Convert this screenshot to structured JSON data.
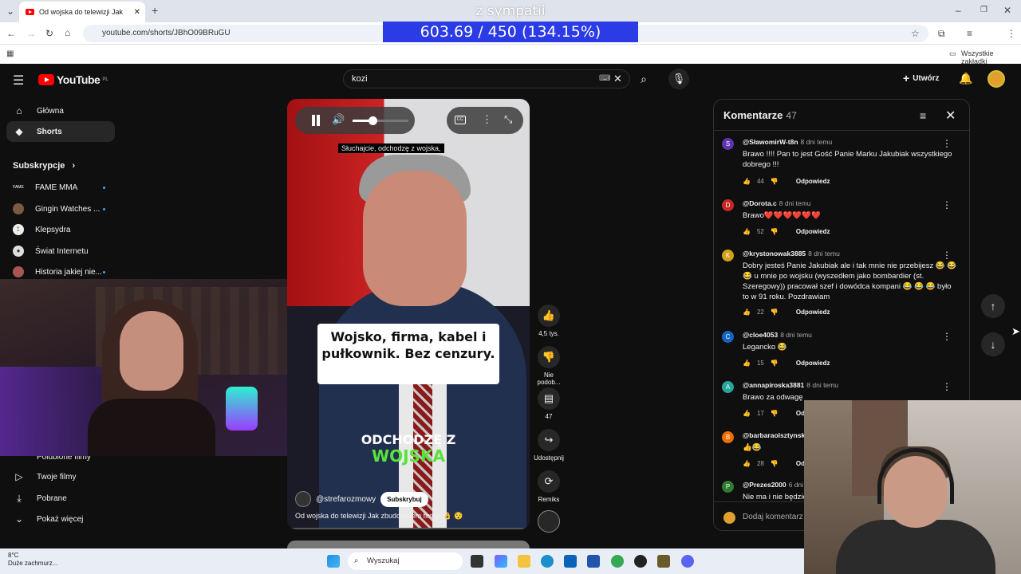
{
  "browser": {
    "tab_title": "Od wojska do telewizji Jak",
    "url": "youtube.com/shorts/JBhO09BRuGU",
    "bookmarks_label": "Wszystkie zakładki"
  },
  "overlay": {
    "top_text": "z sympatii",
    "banner_text": "603.69 / 450 (134.15%)"
  },
  "header": {
    "logo_text": "YouTube",
    "logo_region": "PL",
    "search_value": "kozi",
    "create_label": "Utwórz"
  },
  "sidebar": {
    "items": [
      {
        "label": "Główna",
        "icon": "home-icon"
      },
      {
        "label": "Shorts",
        "icon": "shorts-icon"
      }
    ],
    "subscriptions_label": "Subskrypcje",
    "subscriptions": [
      {
        "label": "FAME MMA"
      },
      {
        "label": "Gingin Watches ..."
      },
      {
        "label": "Klepsydra"
      },
      {
        "label": "Świat Internetu"
      },
      {
        "label": "Historia jakiej nie..."
      }
    ],
    "bottom_items": [
      {
        "label": "Polubione filmy"
      },
      {
        "label": "Twoje filmy"
      },
      {
        "label": "Pobrane"
      },
      {
        "label": "Pokaż więcej"
      }
    ]
  },
  "video": {
    "subtitle": "Słuchajcie, odchodzę z wojska,",
    "caption_box": "Wojsko, firma, kabel i pułkownik. Bez cenzury.",
    "big_line1": "ODCHODZĘ Z",
    "big_line2": "WOJSKA",
    "channel": "@strefarozmowy",
    "subscribe_label": "Subskrybuj",
    "title": "Od wojska do telewizji  Jak zbudowałem firmę! 👌 😯",
    "volume_level": 0.35
  },
  "actions": {
    "like_count": "4,5 tys.",
    "dislike_label": "Nie podob...",
    "comments_count": "47",
    "share_label": "Udostępnij",
    "remix_label": "Remiks"
  },
  "comments": {
    "title": "Komentarze",
    "count": "47",
    "add_placeholder": "Dodaj komentarz",
    "reply_label": "Odpowiedz",
    "items": [
      {
        "author": "@SławomirW-t8n",
        "time": "8 dni temu",
        "text": "Brawo !!!! Pan to jest Gość Panie Marku Jakubiak wszystkiego dobrego !!!",
        "likes": "44",
        "avatar": "S",
        "color": "#5e35b1"
      },
      {
        "author": "@Dorota.c",
        "time": "8 dni temu",
        "text": "Brawo❤️❤️❤️❤️❤️❤️",
        "likes": "52",
        "avatar": "D",
        "color": "#c62828"
      },
      {
        "author": "@krystonowak3885",
        "time": "8 dni temu",
        "text": "Dobry jesteś Panie Jakubiak ale i tak mnie nie przebijesz 😂 😂 😂 u mnie po wojsku (wyszedłem jako bombardier (st. Szeregowy)) pracował szef i dowódca kompani 😂 😂 😂 było to w 91 roku. Pozdrawiam",
        "likes": "22",
        "avatar": "K",
        "color": "#d4a017"
      },
      {
        "author": "@cloe4053",
        "time": "8 dni temu",
        "text": "Legancko 😂",
        "likes": "15",
        "avatar": "C",
        "color": "#1565c0"
      },
      {
        "author": "@annapiroska3881",
        "time": "8 dni temu",
        "text": "Brawo za odwagę",
        "likes": "17",
        "avatar": "A",
        "color": "#26a69a"
      },
      {
        "author": "@barbaraolsztynska",
        "time": "",
        "text": "👍😂",
        "likes": "28",
        "avatar": "B",
        "color": "#ef6c00"
      },
      {
        "author": "@Prezes2000",
        "time": "6 dni t",
        "text": "Nie ma i nie będzie",
        "likes": "",
        "avatar": "P",
        "color": "#2e7d32"
      }
    ]
  },
  "taskbar": {
    "temperature": "8°C",
    "weather": "Duże zachmurz...",
    "search_placeholder": "Wyszukaj"
  }
}
